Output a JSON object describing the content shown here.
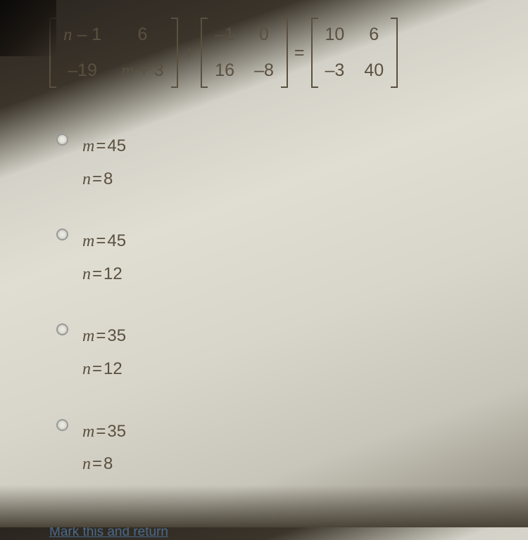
{
  "equation": {
    "matrix_a": {
      "r1c1": "n – 1",
      "r1c2": "6",
      "r2c1": "–19",
      "r2c2": "m + 3"
    },
    "op_plus": "+",
    "matrix_b": {
      "r1c1": "–1",
      "r1c2": "0",
      "r2c1": "16",
      "r2c2": "–8"
    },
    "op_equals": "=",
    "matrix_c": {
      "r1c1": "10",
      "r1c2": "6",
      "r2c1": "–3",
      "r2c2": "40"
    }
  },
  "options": [
    {
      "m_var": "m",
      "m_eq": "=",
      "m_val": "45",
      "n_var": "n",
      "n_eq": "=",
      "n_val": "8"
    },
    {
      "m_var": "m",
      "m_eq": "=",
      "m_val": "45",
      "n_var": "n",
      "n_eq": "=",
      "n_val": "12"
    },
    {
      "m_var": "m",
      "m_eq": "=",
      "m_val": "35",
      "n_var": "n",
      "n_eq": "=",
      "n_val": "12"
    },
    {
      "m_var": "m",
      "m_eq": "=",
      "m_val": "35",
      "n_var": "n",
      "n_eq": "=",
      "n_val": "8"
    }
  ],
  "link": "Mark this and return"
}
